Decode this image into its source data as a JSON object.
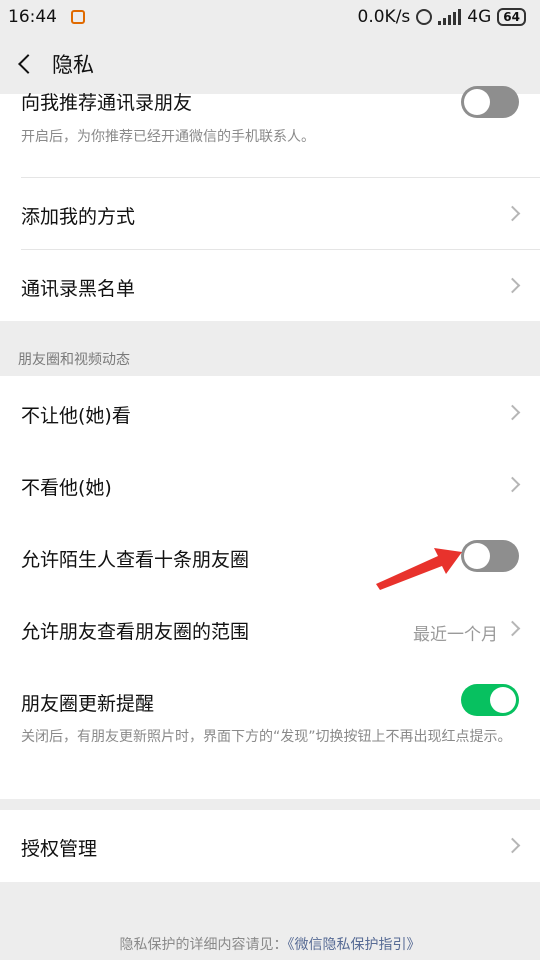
{
  "status_bar": {
    "time": "16:44",
    "network_speed": "0.0K/s",
    "network_type": "4G",
    "battery": "64",
    "icons": [
      "app-notification-icon",
      "alarm-icon",
      "signal-icon",
      "battery-icon"
    ]
  },
  "nav": {
    "title": "隐私",
    "back_icon": "back-arrow-icon"
  },
  "sections": {
    "contacts": {
      "recommend_title": "向我推荐通讯录朋友",
      "recommend_desc": "开启后，为你推荐已经开通微信的手机联系人。",
      "recommend_on": false,
      "add_methods": "添加我的方式",
      "blacklist": "通讯录黑名单"
    },
    "moments_label": "朋友圈和视频动态",
    "moments": {
      "dont_let_see": "不让他(她)看",
      "dont_see": "不看他(她)",
      "stranger_view": "允许陌生人查看十条朋友圈",
      "stranger_view_on": false,
      "friend_range": "允许朋友查看朋友圈的范围",
      "friend_range_value": "最近一个月",
      "update_reminder": "朋友圈更新提醒",
      "update_reminder_on": true,
      "update_reminder_desc": "关闭后，有朋友更新照片时，界面下方的“发现”切换按钮上不再出现红点提示。"
    },
    "auth": {
      "auth_manage": "授权管理"
    }
  },
  "footer": {
    "prefix": "隐私保护的详细内容请见：",
    "link": "《微信隐私保护指引》"
  },
  "colors": {
    "toggle_on": "#07c160",
    "toggle_off": "#8e8e8e",
    "annotation_arrow": "#e8322c",
    "link": "#576b95"
  }
}
